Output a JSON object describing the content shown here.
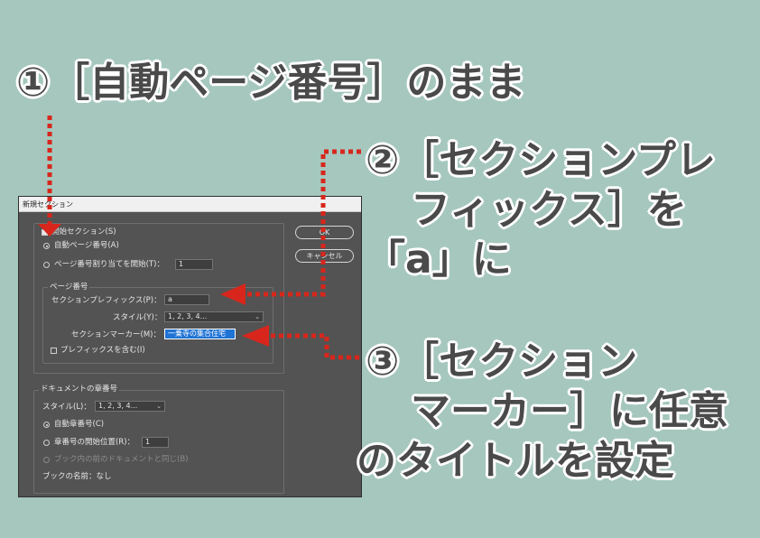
{
  "callouts": {
    "c1": "①［自動ページ番号］のまま",
    "c2_line1": "②［セクションプレ",
    "c2_line2": "フィックス］を",
    "c2_line3": "「a」に",
    "c3_line1": "③［セクション",
    "c3_line2": "マーカー］に任意",
    "c3_line3": "のタイトルを設定"
  },
  "dialog": {
    "title": "新規セクション",
    "start_section": "開始セクション(S)",
    "auto_page": "自動ページ番号(A)",
    "start_page": "ページ番号割り当てを開始(T)：",
    "start_page_value": "1",
    "ok": "OK",
    "cancel": "キャンセル",
    "page_number_group": "ページ番号",
    "section_prefix_label": "セクションプレフィックス(P)：",
    "section_prefix_value": "a",
    "style_label": "スタイル(Y)：",
    "style_value": "1, 2, 3, 4...",
    "section_marker_label": "セクションマーカー(M)：",
    "section_marker_value": "一乗寺の集合住宅",
    "include_prefix": "プレフィックスを含む(I)",
    "doc_chapter_group": "ドキュメントの章番号",
    "chapter_style_label": "スタイル(L)：",
    "chapter_style_value": "1, 2, 3, 4...",
    "auto_chapter": "自動章番号(C)",
    "chapter_start": "章番号の開始位置(R)：",
    "chapter_start_value": "1",
    "same_as_prev": "ブック内の前のドキュメントと同じ(B)",
    "book_name": "ブックの名前：なし"
  },
  "colors": {
    "accent_arrow": "#d8261c",
    "background": "#a5c7be",
    "text": "#4a4a4a"
  }
}
